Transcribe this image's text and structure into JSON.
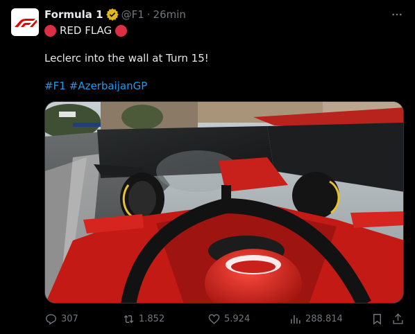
{
  "post": {
    "author_name": "Formula 1",
    "handle": "@F1",
    "separator": "·",
    "time": "26min",
    "line1_text": "RED FLAG",
    "line2_text": "Leclerc into the wall at Turn 15!",
    "hashtags": [
      "#F1",
      "#AzerbaijanGP"
    ]
  },
  "actions": {
    "replies": "307",
    "reposts": "1.852",
    "likes": "5.924",
    "views": "288.814"
  },
  "colors": {
    "background": "#000000",
    "text": "#e7e9ea",
    "muted": "#71767b",
    "link": "#1d9bf0",
    "verified": "#e2b719",
    "brand_red": "#e10600"
  },
  "icons": [
    "f1-logo-icon",
    "verified-badge-icon",
    "more-icon",
    "red-circle-icon",
    "reply-icon",
    "repost-icon",
    "like-icon",
    "views-icon",
    "bookmark-icon",
    "share-icon"
  ]
}
